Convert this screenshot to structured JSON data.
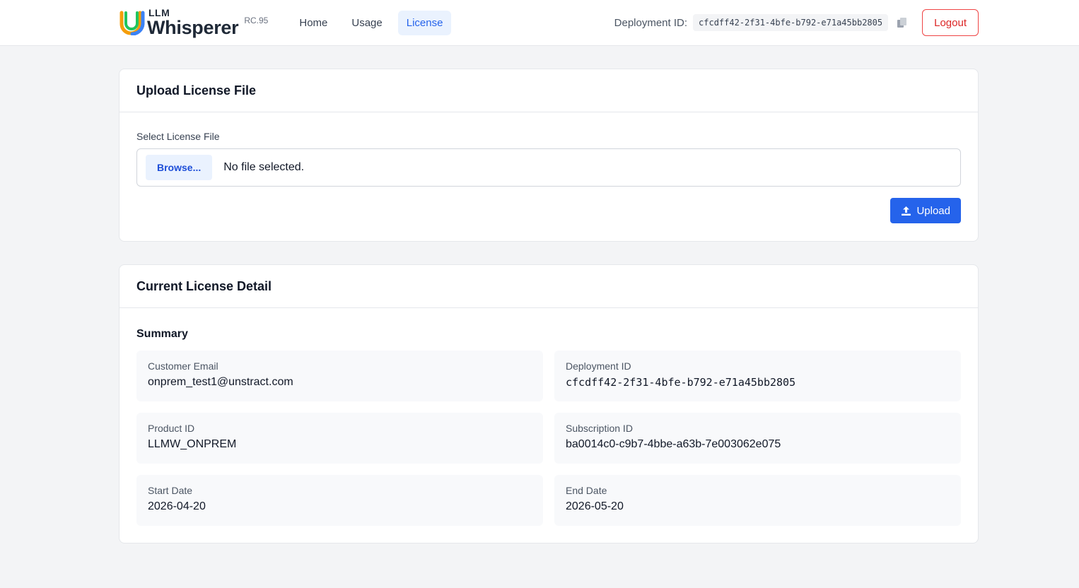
{
  "header": {
    "logo_small": "LLM",
    "logo_name": "Whisperer",
    "version": "RC.95",
    "nav": [
      {
        "label": "Home"
      },
      {
        "label": "Usage"
      },
      {
        "label": "License"
      }
    ],
    "deployment_label": "Deployment ID:",
    "deployment_id": "cfcdff42-2f31-4bfe-b792-e71a45bb2805",
    "copy_icon": "copy-icon",
    "logout_label": "Logout"
  },
  "upload_card": {
    "title": "Upload License File",
    "field_label": "Select License File",
    "browse_label": "Browse...",
    "file_status": "No file selected.",
    "upload_label": "Upload",
    "upload_icon": "upload-icon"
  },
  "detail_card": {
    "title": "Current License Detail",
    "summary_title": "Summary",
    "fields": [
      {
        "label": "Customer Email",
        "value": "onprem_test1@unstract.com"
      },
      {
        "label": "Deployment ID",
        "value": "cfcdff42-2f31-4bfe-b792-e71a45bb2805"
      },
      {
        "label": "Product ID",
        "value": "LLMW_ONPREM"
      },
      {
        "label": "Subscription ID",
        "value": "ba0014c0-c9b7-4bbe-a63b-7e003062e075"
      },
      {
        "label": "Start Date",
        "value": "2026-04-20"
      },
      {
        "label": "End Date",
        "value": "2026-05-20"
      }
    ]
  },
  "colors": {
    "primary": "#2563eb",
    "active_nav_bg": "#eaf2fe",
    "logout": "#dc2626",
    "page_bg": "#f3f4f6"
  }
}
